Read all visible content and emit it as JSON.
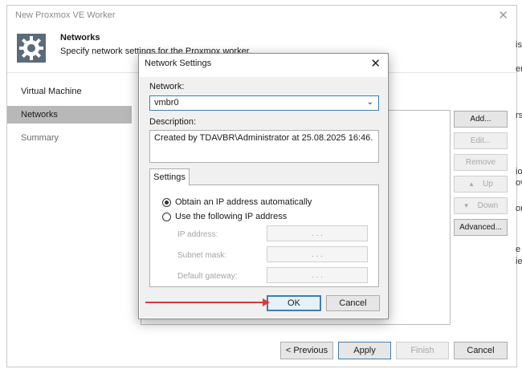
{
  "wizard": {
    "title": "New Proxmox VE Worker",
    "close_glyph": "✕",
    "header_title": "Networks",
    "header_desc": "Specify network settings for the Proxmox worker.",
    "header_icon": "gear-icon"
  },
  "nav": {
    "items": [
      {
        "label": "Virtual Machine",
        "active": false
      },
      {
        "label": "Networks",
        "active": true
      },
      {
        "label": "Summary",
        "active": false
      }
    ]
  },
  "side_buttons": {
    "add": "Add...",
    "edit": "Edit...",
    "remove": "Remove",
    "up": "Up",
    "down": "Down",
    "advanced": "Advanced..."
  },
  "bottom_buttons": {
    "previous": "< Previous",
    "apply": "Apply",
    "finish": "Finish",
    "cancel": "Cancel"
  },
  "right_edge_fragments": [
    "is",
    "er",
    "rs",
    "io",
    "ov",
    "on",
    "e",
    "ie"
  ],
  "dialog": {
    "title": "Network Settings",
    "close_glyph": "✕",
    "network_label": "Network:",
    "network_value": "vmbr0",
    "description_label": "Description:",
    "description_value": "Created by TDAVBR\\Administrator at 25.08.2025 16:46.",
    "settings_tab": "Settings",
    "radio_auto": "Obtain an IP address automatically",
    "radio_manual": "Use the following IP address",
    "ip_address_label": "IP address:",
    "subnet_mask_label": "Subnet mask:",
    "default_gateway_label": "Default gateway:",
    "ip_dots": ".       .       .",
    "ok": "OK",
    "cancel": "Cancel"
  },
  "colors": {
    "accent": "#3c7fb1",
    "annotation": "#d93a3a",
    "nav_active": "#b8b8b8"
  }
}
